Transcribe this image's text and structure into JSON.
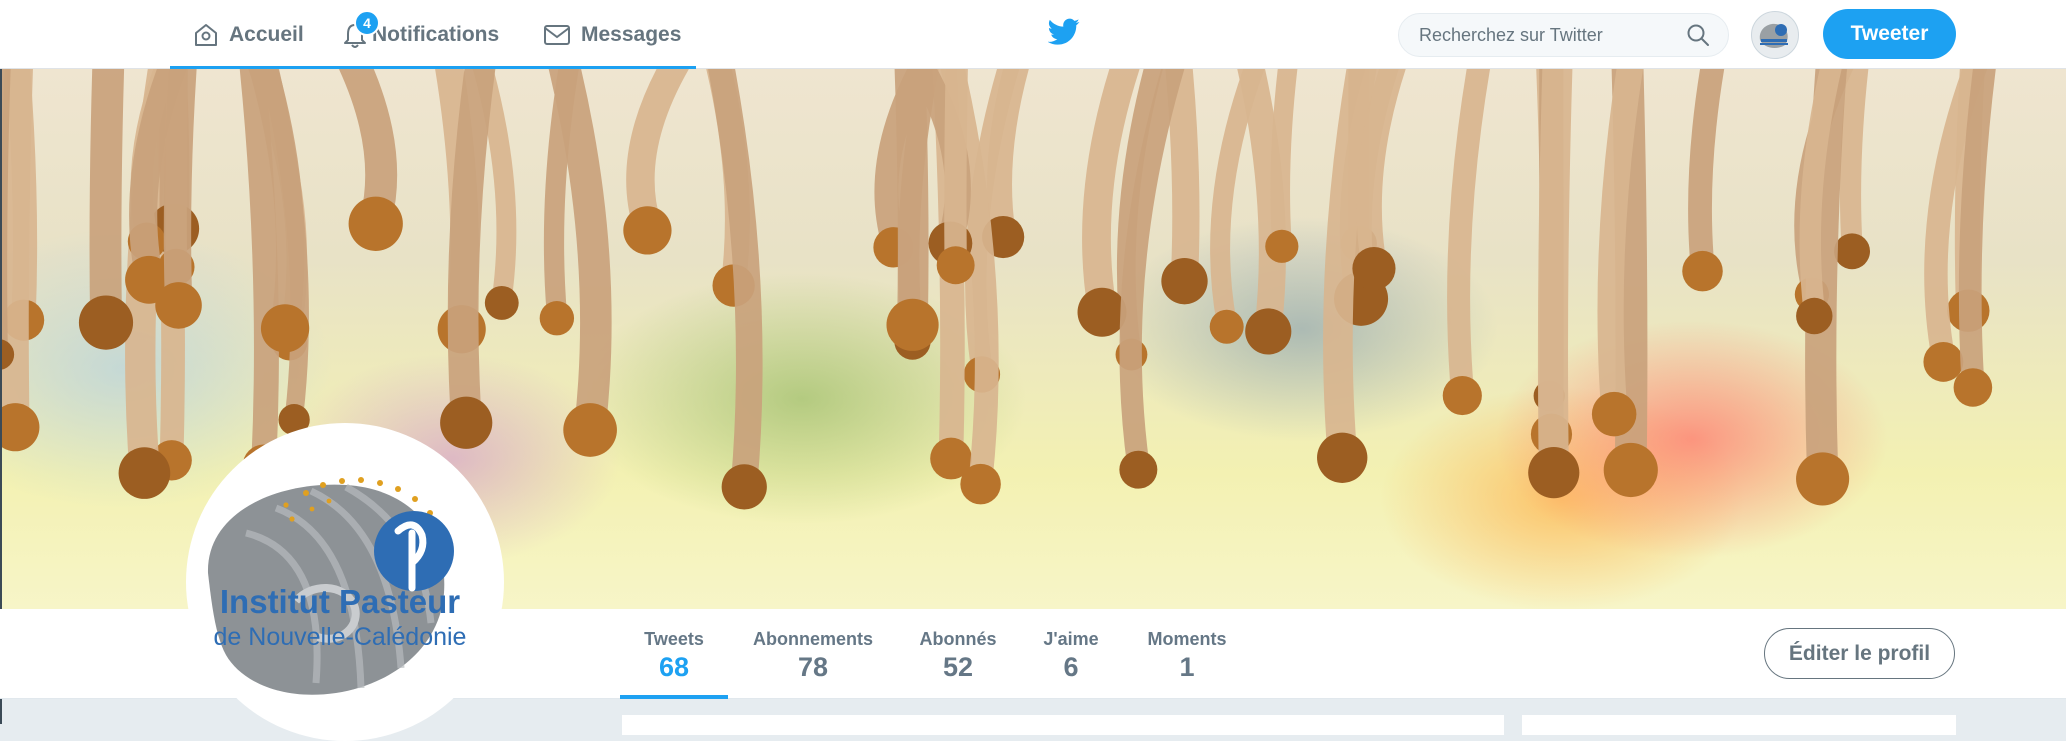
{
  "nav": {
    "home_label": "Accueil",
    "notifications_label": "Notifications",
    "notifications_count": "4",
    "messages_label": "Messages"
  },
  "search": {
    "placeholder": "Recherchez sur Twitter"
  },
  "tweet_button": "Tweeter",
  "profile": {
    "avatar_line1": "Institut Pasteur",
    "avatar_line2": "de Nouvelle-Calédonie",
    "stats": [
      {
        "label": "Tweets",
        "value": "68"
      },
      {
        "label": "Abonnements",
        "value": "78"
      },
      {
        "label": "Abonnés",
        "value": "52"
      },
      {
        "label": "J'aime",
        "value": "6"
      },
      {
        "label": "Moments",
        "value": "1"
      }
    ],
    "edit_button": "Éditer le profil"
  },
  "colors": {
    "accent": "#1da1f2",
    "nav_text": "#66757f",
    "avatar_grey": "#8d9296",
    "avatar_blue": "#2e6db4",
    "avatar_dots": "#e0a020"
  }
}
